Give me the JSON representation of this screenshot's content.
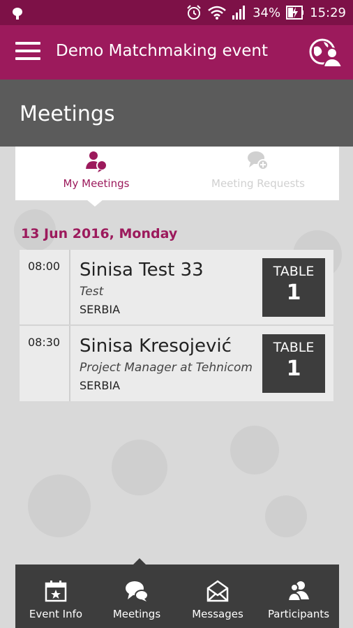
{
  "status_bar": {
    "battery": "34%",
    "time": "15:29"
  },
  "app_bar": {
    "title": "Demo Matchmaking event"
  },
  "page": {
    "title": "Meetings"
  },
  "tabs": [
    {
      "label": "My Meetings",
      "active": true
    },
    {
      "label": "Meeting Requests",
      "active": false
    }
  ],
  "date_heading": "13 Jun 2016, Monday",
  "meetings": [
    {
      "time": "08:00",
      "name": "Sinisa Test 33",
      "role": "Test",
      "country": "SERBIA",
      "table_label": "TABLE",
      "table_number": "1"
    },
    {
      "time": "08:30",
      "name": "Sinisa Kresojević",
      "role": "Project Manager at Tehnicom",
      "country": "SERBIA",
      "table_label": "TABLE",
      "table_number": "1"
    }
  ],
  "bottom_nav": [
    {
      "label": "Event Info",
      "icon": "calendar-star-icon"
    },
    {
      "label": "Meetings",
      "icon": "chat-bubbles-icon"
    },
    {
      "label": "Messages",
      "icon": "envelope-icon"
    },
    {
      "label": "Participants",
      "icon": "people-icon"
    }
  ],
  "colors": {
    "primary": "#9c1a5c",
    "status_bar": "#7d1147",
    "header_band": "#5b5b5b",
    "nav_bg": "#3d3d3d"
  }
}
